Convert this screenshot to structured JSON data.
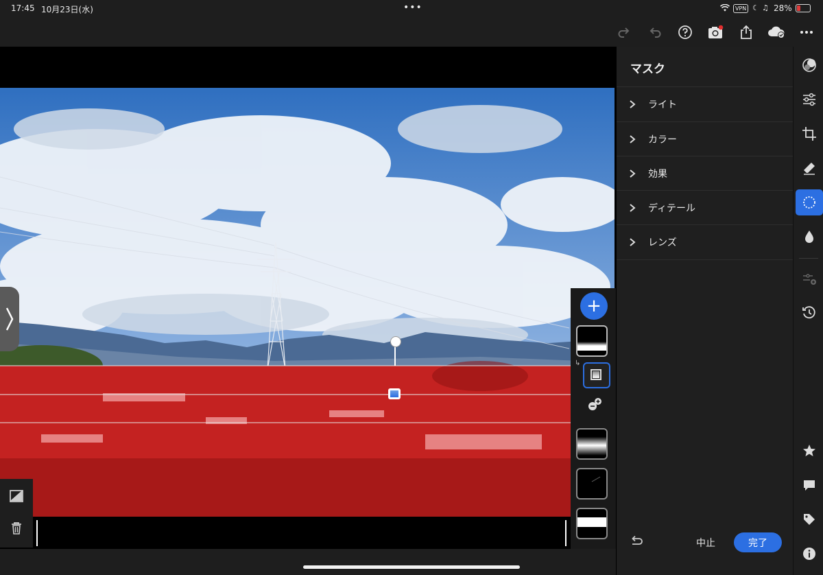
{
  "status": {
    "time": "17:45",
    "date": "10月23日(水)",
    "dots": "•••",
    "vpn": "VPN",
    "battery": "28%"
  },
  "panel": {
    "title": "マスク",
    "sections": [
      "ライト",
      "カラー",
      "効果",
      "ディテール",
      "レンズ"
    ],
    "cancel": "中止",
    "done": "完了"
  },
  "mask_strip": {
    "add": "+"
  },
  "icons": [
    "redo-icon",
    "undo-icon",
    "help-icon",
    "camera-icon",
    "share-icon",
    "cloud-sync-icon",
    "more-icon",
    "presets-icon",
    "edit-sliders-icon",
    "crop-icon",
    "healing-icon",
    "masking-icon",
    "blur-icon",
    "adjust-add-icon",
    "history-icon",
    "star-icon",
    "comment-icon",
    "tag-icon",
    "info-icon",
    "invert-mask-icon",
    "trash-icon",
    "reset-icon"
  ],
  "colors": {
    "accent": "#2c6fe2",
    "mask_overlay": "#d11f1f",
    "background": "#1e1e1e"
  }
}
